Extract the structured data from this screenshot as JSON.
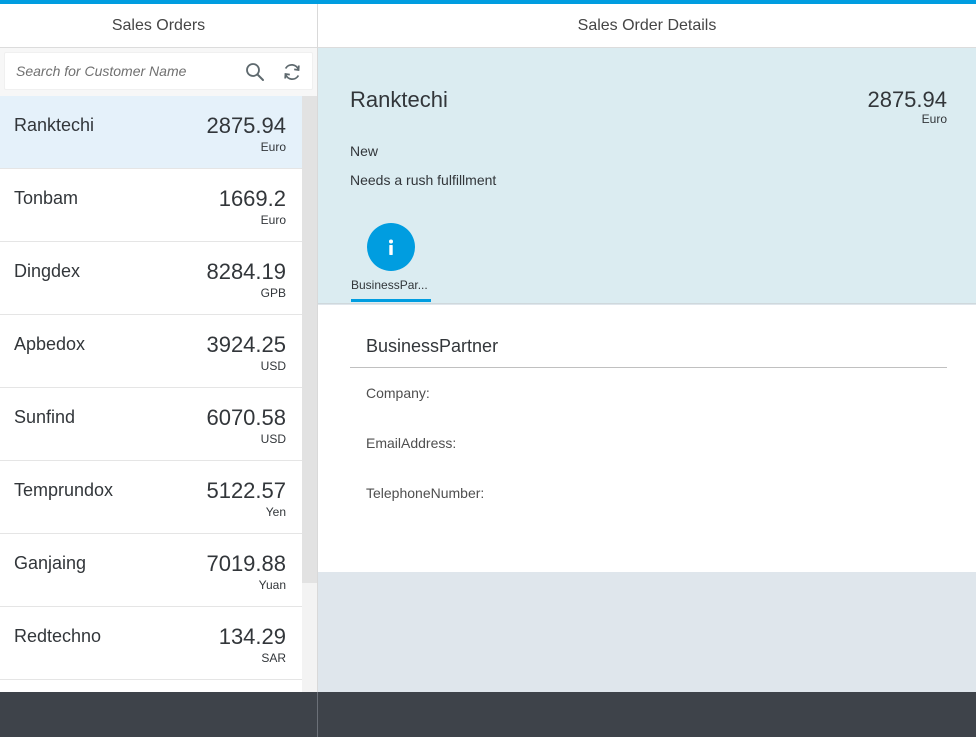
{
  "colors": {
    "accent": "#009de0",
    "selected_row": "#e5f1fa",
    "object_header_bg": "#dbecf1",
    "detail_bg": "#dfe6ec",
    "footer_bg": "#3e434a"
  },
  "master": {
    "title": "Sales Orders",
    "search": {
      "placeholder": "Search for Customer Name",
      "value": ""
    },
    "icons": {
      "search": "search-icon",
      "refresh": "refresh-icon"
    },
    "items": [
      {
        "name": "Ranktechi",
        "amount": "2875.94",
        "unit": "Euro",
        "selected": true
      },
      {
        "name": "Tonbam",
        "amount": "1669.2",
        "unit": "Euro"
      },
      {
        "name": "Dingdex",
        "amount": "8284.19",
        "unit": "GPB"
      },
      {
        "name": "Apbedox",
        "amount": "3924.25",
        "unit": "USD"
      },
      {
        "name": "Sunfind",
        "amount": "6070.58",
        "unit": "USD"
      },
      {
        "name": "Temprundox",
        "amount": "5122.57",
        "unit": "Yen"
      },
      {
        "name": "Ganjaing",
        "amount": "7019.88",
        "unit": "Yuan"
      },
      {
        "name": "Redtechno",
        "amount": "134.29",
        "unit": "SAR"
      }
    ]
  },
  "detail": {
    "title": "Sales Order Details",
    "object": {
      "title": "Ranktechi",
      "number": "2875.94",
      "unit": "Euro",
      "status": "New",
      "note": "Needs a rush fulfillment"
    },
    "tab": {
      "label": "BusinessPar...",
      "icon": "info-icon"
    },
    "form": {
      "title": "BusinessPartner",
      "fields": [
        "Company:",
        "EmailAddress:",
        "TelephoneNumber:"
      ]
    }
  }
}
